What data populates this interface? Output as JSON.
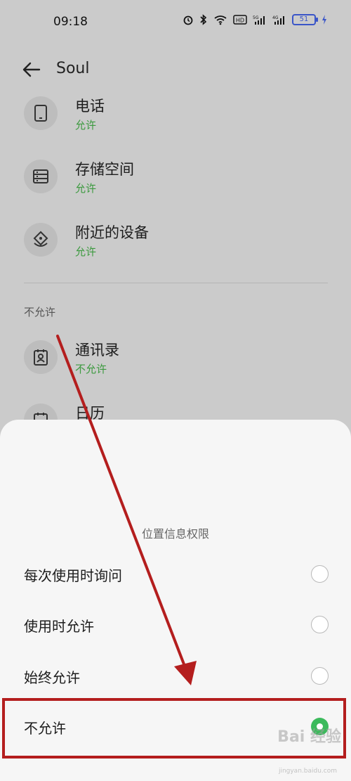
{
  "status_bar": {
    "time": "09:18",
    "battery": "51"
  },
  "app_bar": {
    "title": "Soul"
  },
  "permissions": {
    "allowed": [
      {
        "name": "电话",
        "status": "允许",
        "icon": "phone-icon"
      },
      {
        "name": "存储空间",
        "status": "允许",
        "icon": "storage-icon"
      },
      {
        "name": "附近的设备",
        "status": "允许",
        "icon": "nearby-devices-icon"
      }
    ],
    "denied_section_label": "不允许",
    "denied": [
      {
        "name": "通讯录",
        "status": "不允许",
        "icon": "contacts-icon"
      },
      {
        "name": "日历",
        "status": "",
        "icon": "calendar-icon"
      }
    ]
  },
  "sheet": {
    "title": "位置信息权限",
    "options": [
      {
        "label": "每次使用时询问",
        "selected": false
      },
      {
        "label": "使用时允许",
        "selected": false
      },
      {
        "label": "始终允许",
        "selected": false
      },
      {
        "label": "不允许",
        "selected": true
      }
    ]
  },
  "colors": {
    "allowed_green": "#3c9a3f",
    "radio_selected": "#3cba5c",
    "annotation_red": "#b41e1e"
  },
  "watermark": {
    "text": "Bai 经验",
    "sub": "jingyan.baidu.com"
  }
}
